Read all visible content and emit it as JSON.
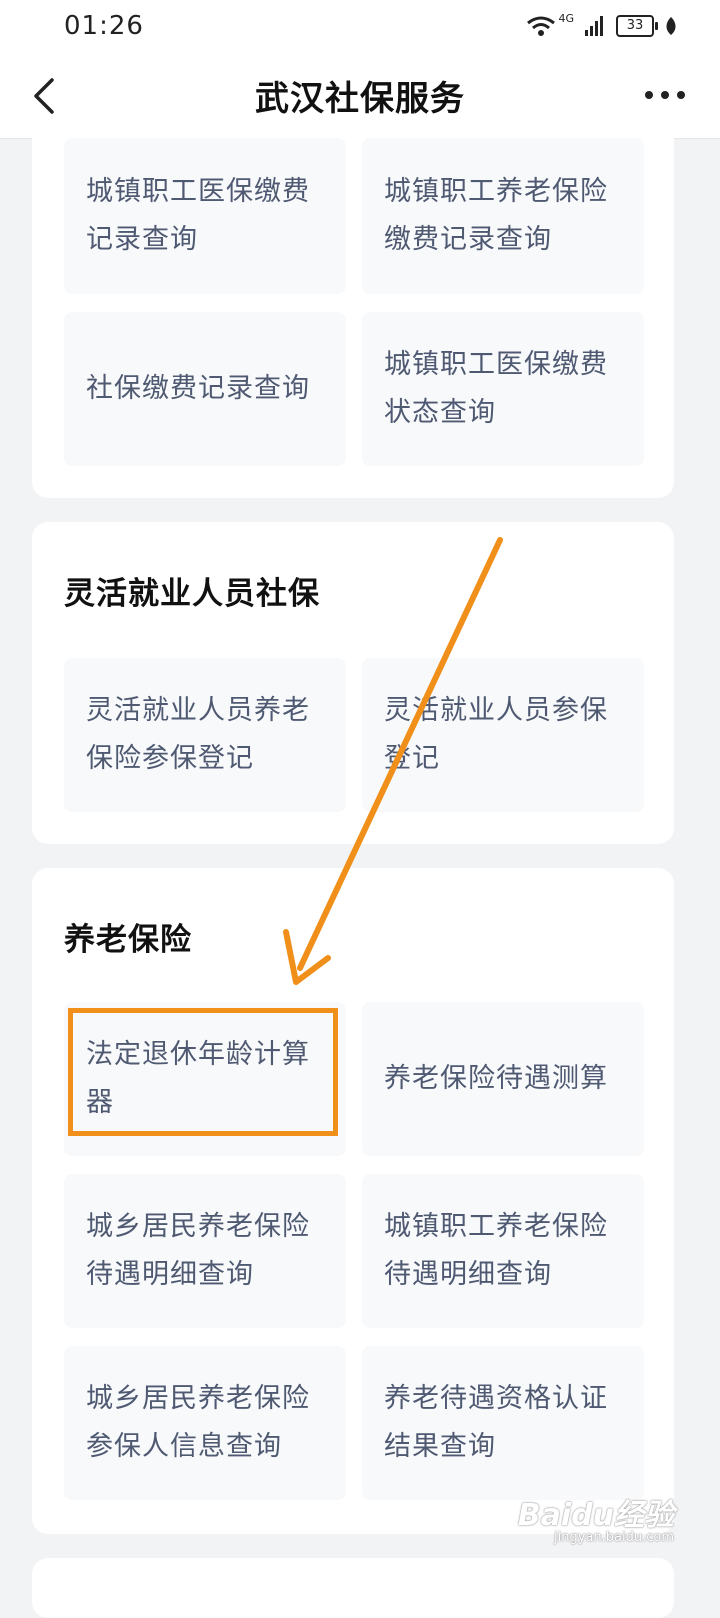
{
  "status_bar": {
    "time": "01:26",
    "network": "4G",
    "battery": "33"
  },
  "nav": {
    "title": "武汉社保服务"
  },
  "sections": [
    {
      "title": "",
      "items": [
        {
          "label": "城镇职工医保缴费记录查询"
        },
        {
          "label": "城镇职工养老保险缴费记录查询"
        },
        {
          "label": "社保缴费记录查询"
        },
        {
          "label": "城镇职工医保缴费状态查询"
        }
      ]
    },
    {
      "title": "灵活就业人员社保",
      "items": [
        {
          "label": "灵活就业人员养老保险参保登记"
        },
        {
          "label": "灵活就业人员参保登记"
        }
      ]
    },
    {
      "title": "养老保险",
      "items": [
        {
          "label": "法定退休年龄计算器"
        },
        {
          "label": "养老保险待遇测算"
        },
        {
          "label": "城乡居民养老保险待遇明细查询"
        },
        {
          "label": "城镇职工养老保险待遇明细查询"
        },
        {
          "label": "城乡居民养老保险参保人信息查询"
        },
        {
          "label": "养老待遇资格认证结果查询"
        }
      ]
    }
  ],
  "annotation": {
    "highlight_color": "#f0901a"
  },
  "watermark": {
    "logo": "Baidu经验",
    "url": "jingyan.baidu.com"
  },
  "colors": {
    "tile_text": "#4f5a72",
    "tile_bg": "#f8f9fb",
    "page_bg": "#f2f3f5"
  }
}
